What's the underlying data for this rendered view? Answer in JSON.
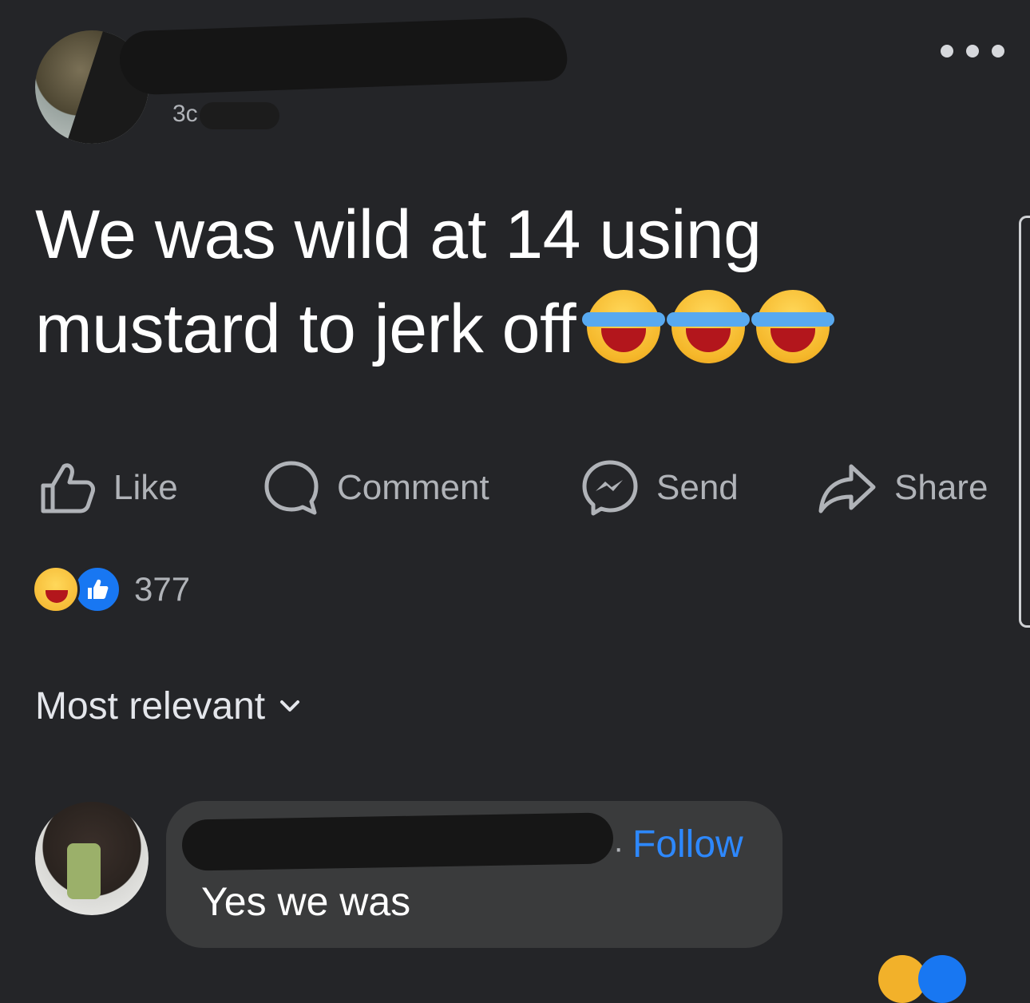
{
  "post": {
    "author_time": "3с",
    "text": "We was wild at 14 using mustard to jerk off",
    "emojis": [
      "laughing-tears",
      "laughing-tears",
      "laughing-tears"
    ]
  },
  "actions": {
    "like": "Like",
    "comment": "Comment",
    "send": "Send",
    "share": "Share"
  },
  "reactions": {
    "types": [
      "haha",
      "like"
    ],
    "count": "377"
  },
  "sort": {
    "label": "Most relevant"
  },
  "comment": {
    "separator": "·",
    "follow_label": "Follow",
    "text": "Yes we was"
  },
  "colors": {
    "background": "#242528",
    "bubble": "#3a3b3c",
    "link_blue": "#2d88ff",
    "like_blue": "#1877f2",
    "muted_text": "#b0b3b8"
  }
}
